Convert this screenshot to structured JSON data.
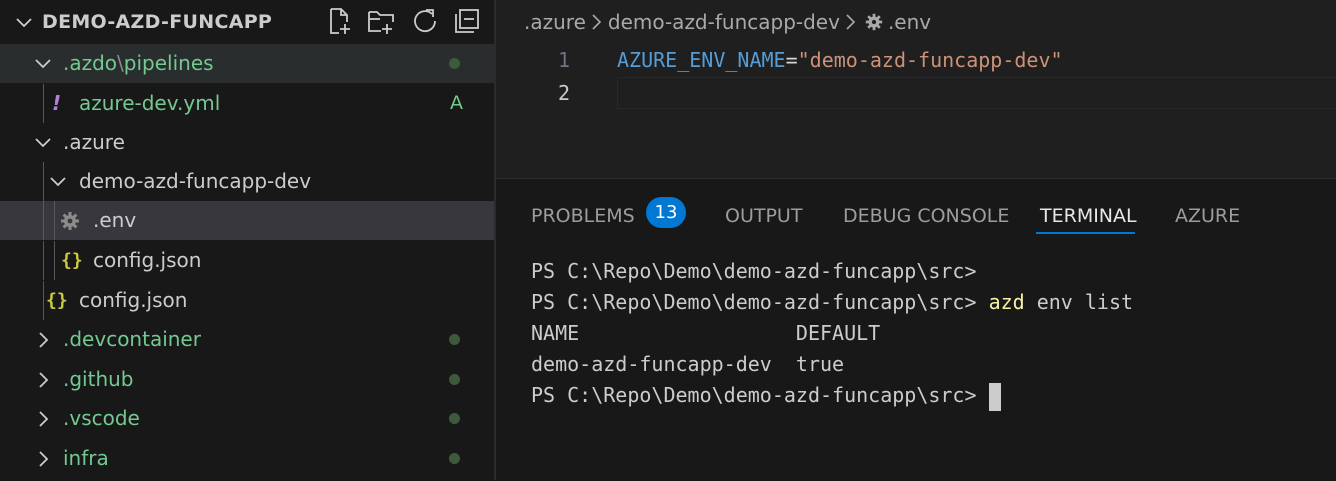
{
  "explorer": {
    "title": "DEMO-AZD-FUNCAPP",
    "actions": [
      "new-file",
      "new-folder",
      "refresh",
      "collapse-all"
    ],
    "tree": {
      "azdo_folder": "azdo",
      "azdo_prefix": ".",
      "azdo_sep": "\\",
      "azdo_sub": "pipelines",
      "azure_dev_icon": "!",
      "azure_dev_file": "azure-dev.yml",
      "azure_dev_status": "A",
      "azure_folder": ".azure",
      "env_folder": "demo-azd-funcapp-dev",
      "env_file": ".env",
      "env_config_icon": "{}",
      "env_config_file": "config.json",
      "azure_config_icon": "{}",
      "azure_config_file": "config.json",
      "devcontainer": ".devcontainer",
      "github": ".github",
      "vscode": ".vscode",
      "infra": "infra"
    }
  },
  "editor": {
    "breadcrumb": [
      ".azure",
      "demo-azd-funcapp-dev",
      ".env"
    ],
    "lines": [
      {
        "number": "1",
        "key": "AZURE_ENV_NAME",
        "eq": "=",
        "value": "\"demo-azd-funcapp-dev\""
      },
      {
        "number": "2"
      }
    ]
  },
  "panel": {
    "tabs": {
      "problems": "PROBLEMS",
      "problems_count": "13",
      "output": "OUTPUT",
      "debug": "DEBUG CONSOLE",
      "terminal": "TERMINAL",
      "azure": "AZURE"
    },
    "active_tab": "TERMINAL",
    "terminal": {
      "line1": "PS C:\\Repo\\Demo\\demo-azd-funcapp\\src>",
      "line2_prompt": "PS C:\\Repo\\Demo\\demo-azd-funcapp\\src> ",
      "line2_cmd": "azd",
      "line2_args": " env list",
      "line3": "NAME                  DEFAULT",
      "line4": "demo-azd-funcapp-dev  true",
      "line5_prompt": "PS C:\\Repo\\Demo\\demo-azd-funcapp\\src> "
    }
  },
  "colors": {
    "accent": "#0078d4",
    "git_added": "#73c991",
    "selection": "#37373d"
  }
}
